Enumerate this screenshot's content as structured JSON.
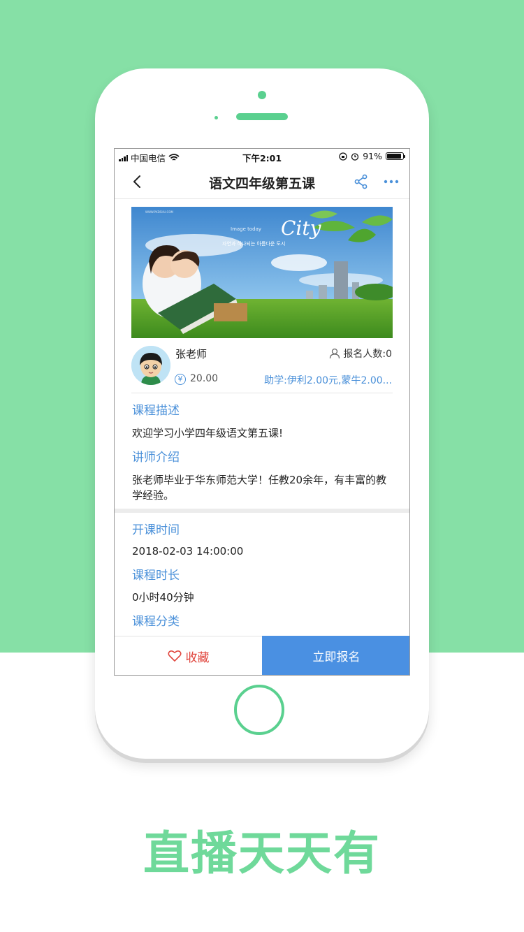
{
  "status_bar": {
    "carrier": "中国电信",
    "time": "下午2:01",
    "battery": "91%"
  },
  "nav": {
    "title": "语文四年级第五课",
    "back_icon": "chevron-left-icon",
    "share_icon": "share-icon",
    "more_icon": "more-dots-icon"
  },
  "banner": {
    "city_text": "City",
    "image_today": "Image today",
    "korean_caption": "자연과 하나되는 아름다운 도시",
    "site": "WWW.PKDSHU.COM"
  },
  "course": {
    "teacher_name": "张老师",
    "price_symbol": "¥",
    "price": "20.00",
    "enroll_label": "报名人数:0",
    "assist": "助学:伊利2.00元,蒙牛2.00..."
  },
  "sections": {
    "desc_title": "课程描述",
    "desc_text": "欢迎学习小学四年级语文第五课!",
    "lecturer_title": "讲师介绍",
    "lecturer_text": "张老师毕业于华东师范大学！任教20余年，有丰富的教学经验。",
    "start_title": "开课时间",
    "start_text": "2018-02-03 14:00:00",
    "duration_title": "课程时长",
    "duration_text": "0小时40分钟",
    "category_title": "课程分类"
  },
  "bottom": {
    "favorite_label": "收藏",
    "signup_label": "立即报名"
  },
  "slogan": "直播天天有",
  "colors": {
    "background_green": "#86e0a6",
    "accent_blue": "#4a90e2",
    "favorite_red": "#e0463e",
    "slogan_green": "#6fd99a"
  }
}
